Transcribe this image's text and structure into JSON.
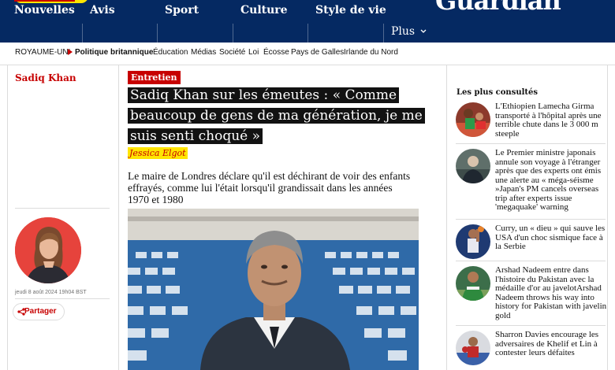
{
  "brand": {
    "logo": "Guardian",
    "support_button": "",
    "colors": {
      "navy": "#052962",
      "red": "#c70000",
      "yellow": "#ffe500"
    }
  },
  "nav": {
    "items": [
      "Nouvelles",
      "Avis",
      "Sport",
      "Culture",
      "Style de vie"
    ],
    "more": "Plus"
  },
  "subnav": {
    "items": [
      "ROYAUME-UNI",
      "Politique britannique",
      "Éducation",
      "Médias",
      "Société",
      "Loi",
      "Écosse",
      "Pays de Galles",
      "Irlande du Nord"
    ]
  },
  "left_column": {
    "tag": "Sadiq Khan",
    "date": "jeudi 8 août 2024 19h04 BST",
    "share_label": "Partager"
  },
  "article": {
    "kicker": "Entretien",
    "headline": "Sadiq Khan sur les émeutes : « Comme beaucoup de gens de ma génération, je me suis senti choqué »",
    "byline": "Jessica Elgot",
    "standfirst": "Le maire de Londres déclare qu'il est déchirant de voir des enfants effrayés, comme lui l'était lorsqu'il grandissait dans les années 1970 et 1980"
  },
  "most_viewed": {
    "title": "Les plus consultés",
    "items": [
      "L'Ethiopien Lamecha Girma transporté à l'hôpital après une terrible chute dans le 3 000 m steeple",
      "Le Premier ministre japonais annule son voyage à l'étranger après que des experts ont émis une alerte au « méga-séisme »Japan's PM cancels overseas trip after experts issue 'megaquake' warning",
      "Curry, un « dieu » qui sauve les USA d'un choc sismique face à la Serbie",
      "Arshad Nadeem entre dans l'histoire du Pakistan avec la médaille d'or au javelotArshad Nadeem throws his way into history for Pakistan with javelin gold",
      "Sharron Davies encourage les adversaires de Khelif et Lin à contester leurs défaites"
    ]
  }
}
